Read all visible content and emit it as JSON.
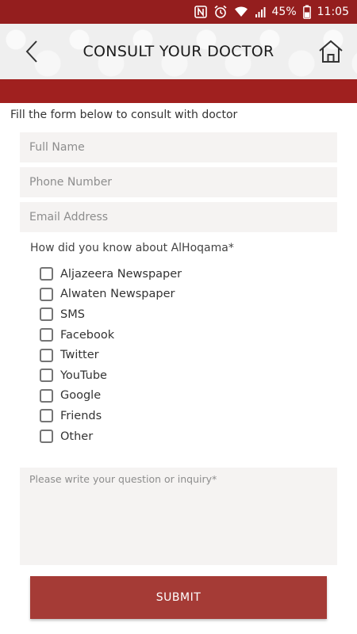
{
  "status_bar": {
    "battery_percent": "45%",
    "time": "11:05"
  },
  "header": {
    "title": "CONSULT YOUR DOCTOR"
  },
  "form": {
    "intro": "Fill the form below to consult with doctor",
    "full_name": {
      "placeholder": "Full Name",
      "value": ""
    },
    "phone": {
      "placeholder": "Phone Number",
      "value": ""
    },
    "email": {
      "placeholder": "Email Address",
      "value": ""
    },
    "source_question": "How did you know about AlHoqama*",
    "sources": [
      {
        "label": "Aljazeera Newspaper",
        "checked": false
      },
      {
        "label": "Alwaten Newspaper",
        "checked": false
      },
      {
        "label": "SMS",
        "checked": false
      },
      {
        "label": "Facebook",
        "checked": false
      },
      {
        "label": "Twitter",
        "checked": false
      },
      {
        "label": "YouTube",
        "checked": false
      },
      {
        "label": "Google",
        "checked": false
      },
      {
        "label": "Friends",
        "checked": false
      },
      {
        "label": "Other",
        "checked": false
      }
    ],
    "inquiry": {
      "placeholder": "Please write your question or inquiry*",
      "value": ""
    },
    "submit_label": "SUBMIT"
  },
  "colors": {
    "accent": "#a0201f",
    "status_bar": "#941e1e",
    "field_bg": "#f5f3f2",
    "submit_bg": "#a53b36"
  },
  "icons": {
    "back": "chevron-left-icon",
    "home": "home-icon",
    "nfc": "nfc-icon",
    "alarm": "alarm-icon",
    "wifi": "wifi-icon",
    "signal": "signal-icon",
    "battery": "battery-icon"
  }
}
